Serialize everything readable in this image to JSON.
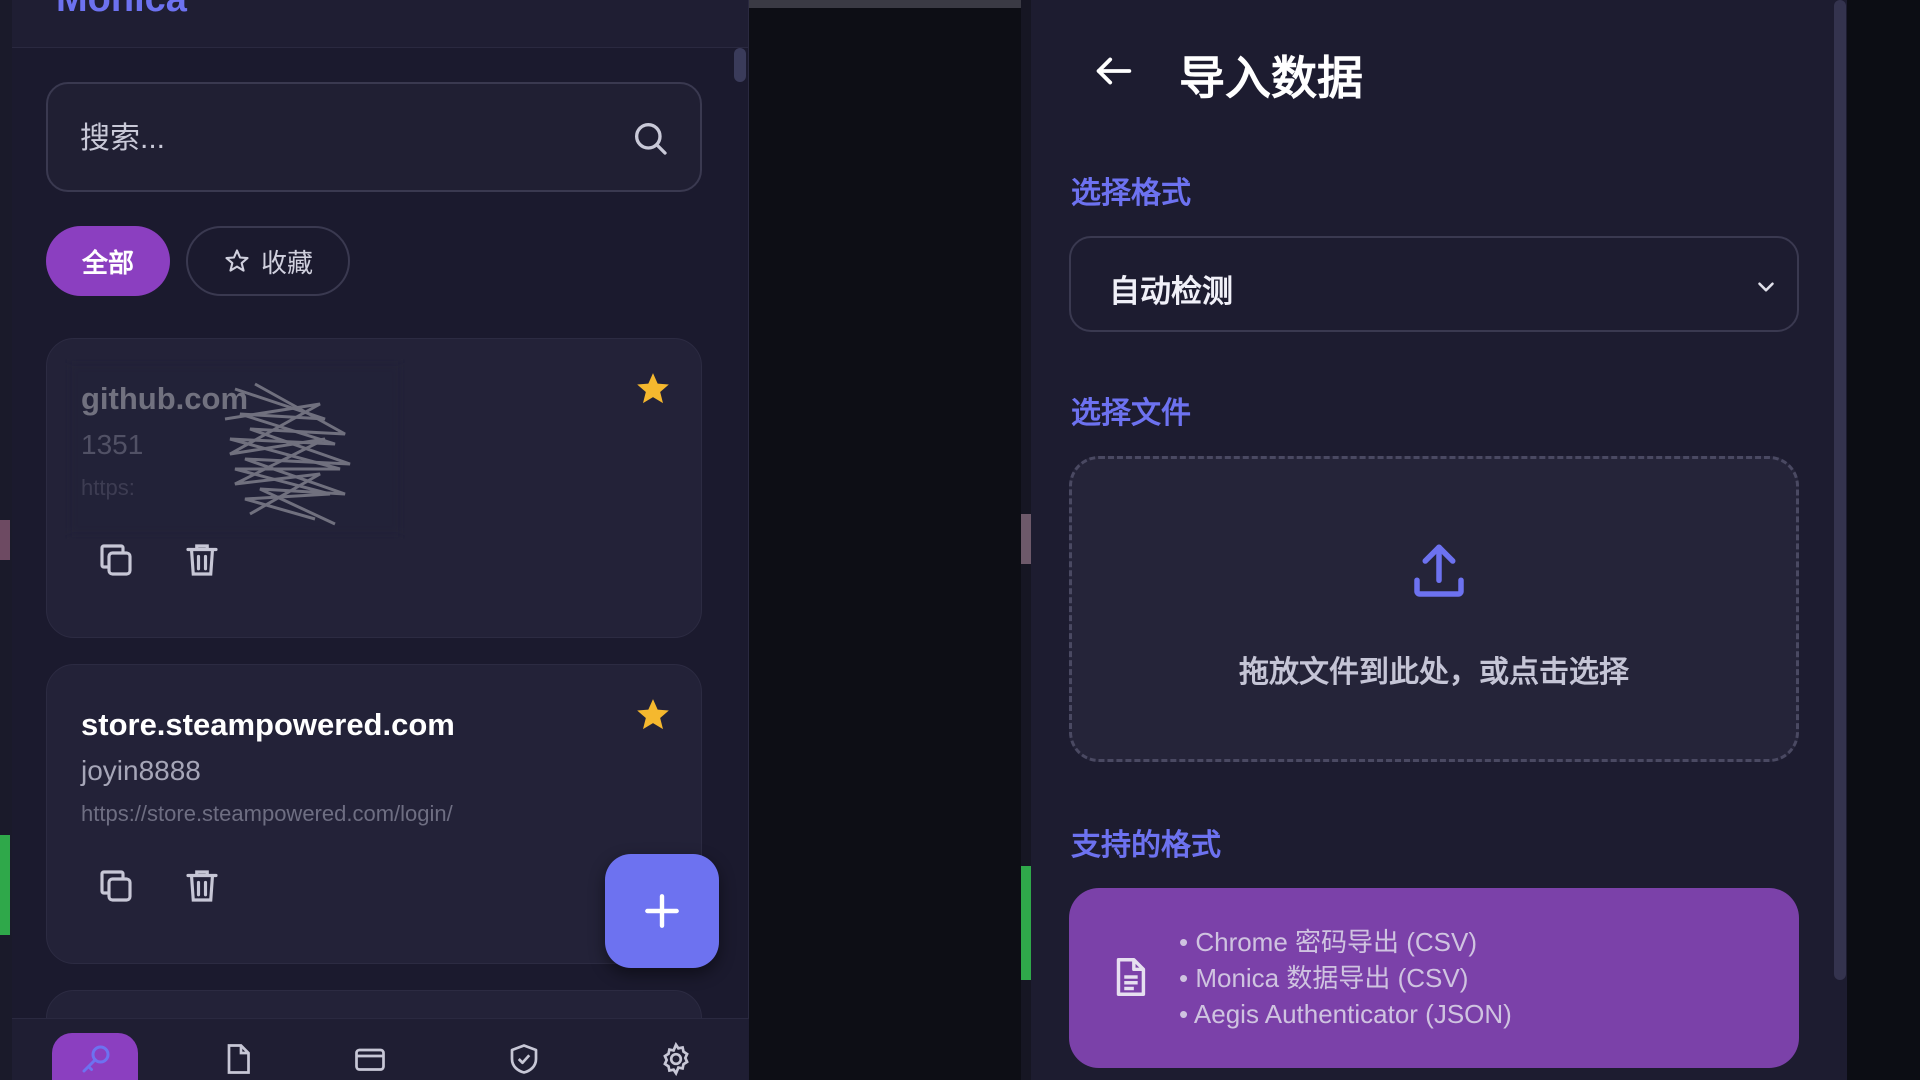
{
  "app": {
    "title": "Monica"
  },
  "search": {
    "placeholder": "搜索..."
  },
  "filters": {
    "all_label": "全部",
    "favorites_label": "收藏"
  },
  "entries": [
    {
      "site": "github.com",
      "username": "1351",
      "url": "https:",
      "favorite": true,
      "obscured": true
    },
    {
      "site": "store.steampowered.com",
      "username": "joyin8888",
      "url": "https://store.steampowered.com/login/",
      "favorite": true,
      "obscured": false
    }
  ],
  "bottom_nav": [
    {
      "icon": "key-icon",
      "active": true
    },
    {
      "icon": "file-icon",
      "active": false
    },
    {
      "icon": "card-icon",
      "active": false
    },
    {
      "icon": "shield-check-icon",
      "active": false
    },
    {
      "icon": "gear-icon",
      "active": false
    }
  ],
  "import_page": {
    "title": "导入数据",
    "format_section_label": "选择格式",
    "format_selected": "自动检测",
    "file_section_label": "选择文件",
    "drop_hint": "拖放文件到此处，或点击选择",
    "supported_section_label": "支持的格式",
    "supported_formats": [
      "Chrome 密码导出 (CSV)",
      "Monica 数据导出 (CSV)",
      "Aegis Authenticator (JSON)"
    ]
  },
  "colors": {
    "accent": "#6d72f0",
    "purple": "#8b3fc0",
    "formats_bg": "#7b41a9",
    "star": "#f5b82e",
    "panel_bg": "#1d1c30"
  }
}
